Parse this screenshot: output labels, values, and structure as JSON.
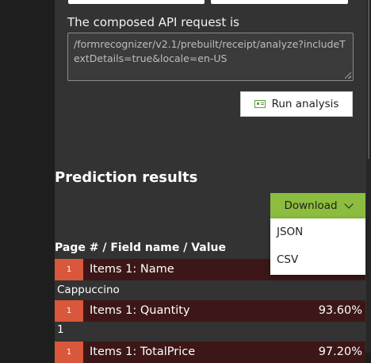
{
  "request": {
    "label": "The composed API request is",
    "url": "/formrecognizer/v2.1/prebuilt/receipt/analyze?includeTextDetails=true&locale=en-US"
  },
  "run_button": {
    "label": "Run analysis",
    "icon": "receipt-icon"
  },
  "results": {
    "title": "Prediction results",
    "column_header": "Page # / Field name / Value",
    "fields": [
      {
        "page": "1",
        "name": "Items 1: Name",
        "confidence": "",
        "value": "Cappuccino"
      },
      {
        "page": "1",
        "name": "Items 1: Quantity",
        "confidence": "93.60%",
        "value": "1"
      },
      {
        "page": "1",
        "name": "Items 1: TotalPrice",
        "confidence": "97.20%",
        "value": ""
      }
    ]
  },
  "download": {
    "label": "Download",
    "options": [
      "JSON",
      "CSV"
    ]
  },
  "colors": {
    "panel": "#333333",
    "accent_green": "#8cbd3e",
    "page_badge": "#d9573a",
    "field_row": "#3d1717"
  }
}
